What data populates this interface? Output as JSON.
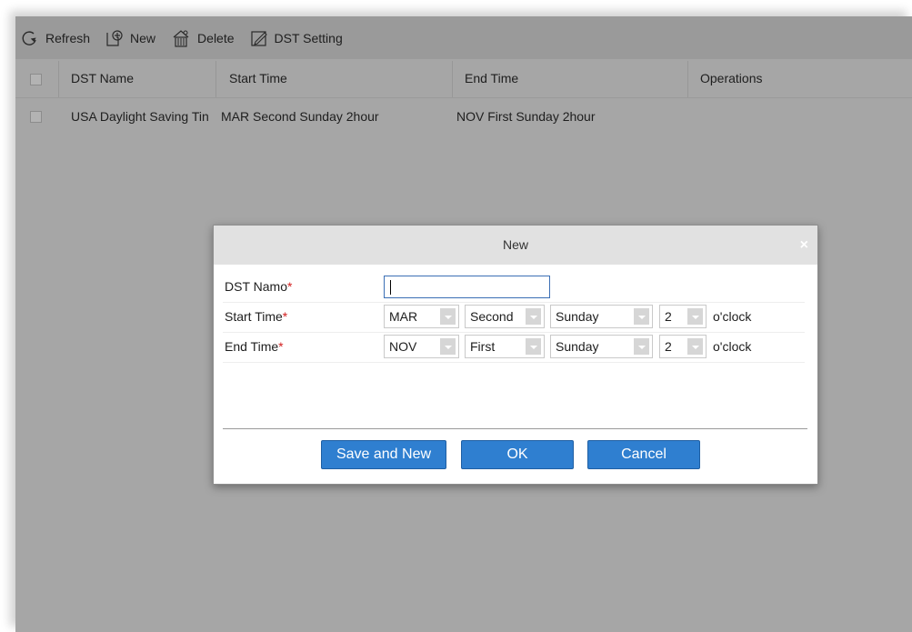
{
  "toolbar": {
    "refresh_label": "Refresh",
    "new_label": "New",
    "delete_label": "Delete",
    "dst_setting_label": "DST Setting"
  },
  "grid": {
    "columns": [
      "DST Name",
      "Start Time",
      "End Time",
      "Operations"
    ],
    "rows": [
      {
        "name": "USA Daylight Saving Tin",
        "start": "MAR Second Sunday 2hour",
        "end": "NOV First Sunday 2hour",
        "operations": ""
      }
    ]
  },
  "dialog": {
    "title": "New",
    "close_symbol": "×",
    "fields": {
      "name_label": "DST Namo",
      "start_label": "Start Time",
      "end_label": "End Time",
      "required_mark": "*",
      "name_value": ""
    },
    "start": {
      "month": "MAR",
      "week": "Second",
      "day": "Sunday",
      "hour": "2",
      "suffix": "o'clock"
    },
    "end": {
      "month": "NOV",
      "week": "First",
      "day": "Sunday",
      "hour": "2",
      "suffix": "o'clock"
    },
    "buttons": {
      "save_new": "Save and New",
      "ok": "OK",
      "cancel": "Cancel"
    }
  },
  "colors": {
    "overlay_gray": "#a6a6a6",
    "button_blue": "#2f7fd0",
    "required_red": "#d32020"
  },
  "icons": [
    "refresh-icon",
    "new-icon",
    "delete-icon",
    "dst-setting-icon",
    "close-icon",
    "dropdown-arrow-icon"
  ]
}
